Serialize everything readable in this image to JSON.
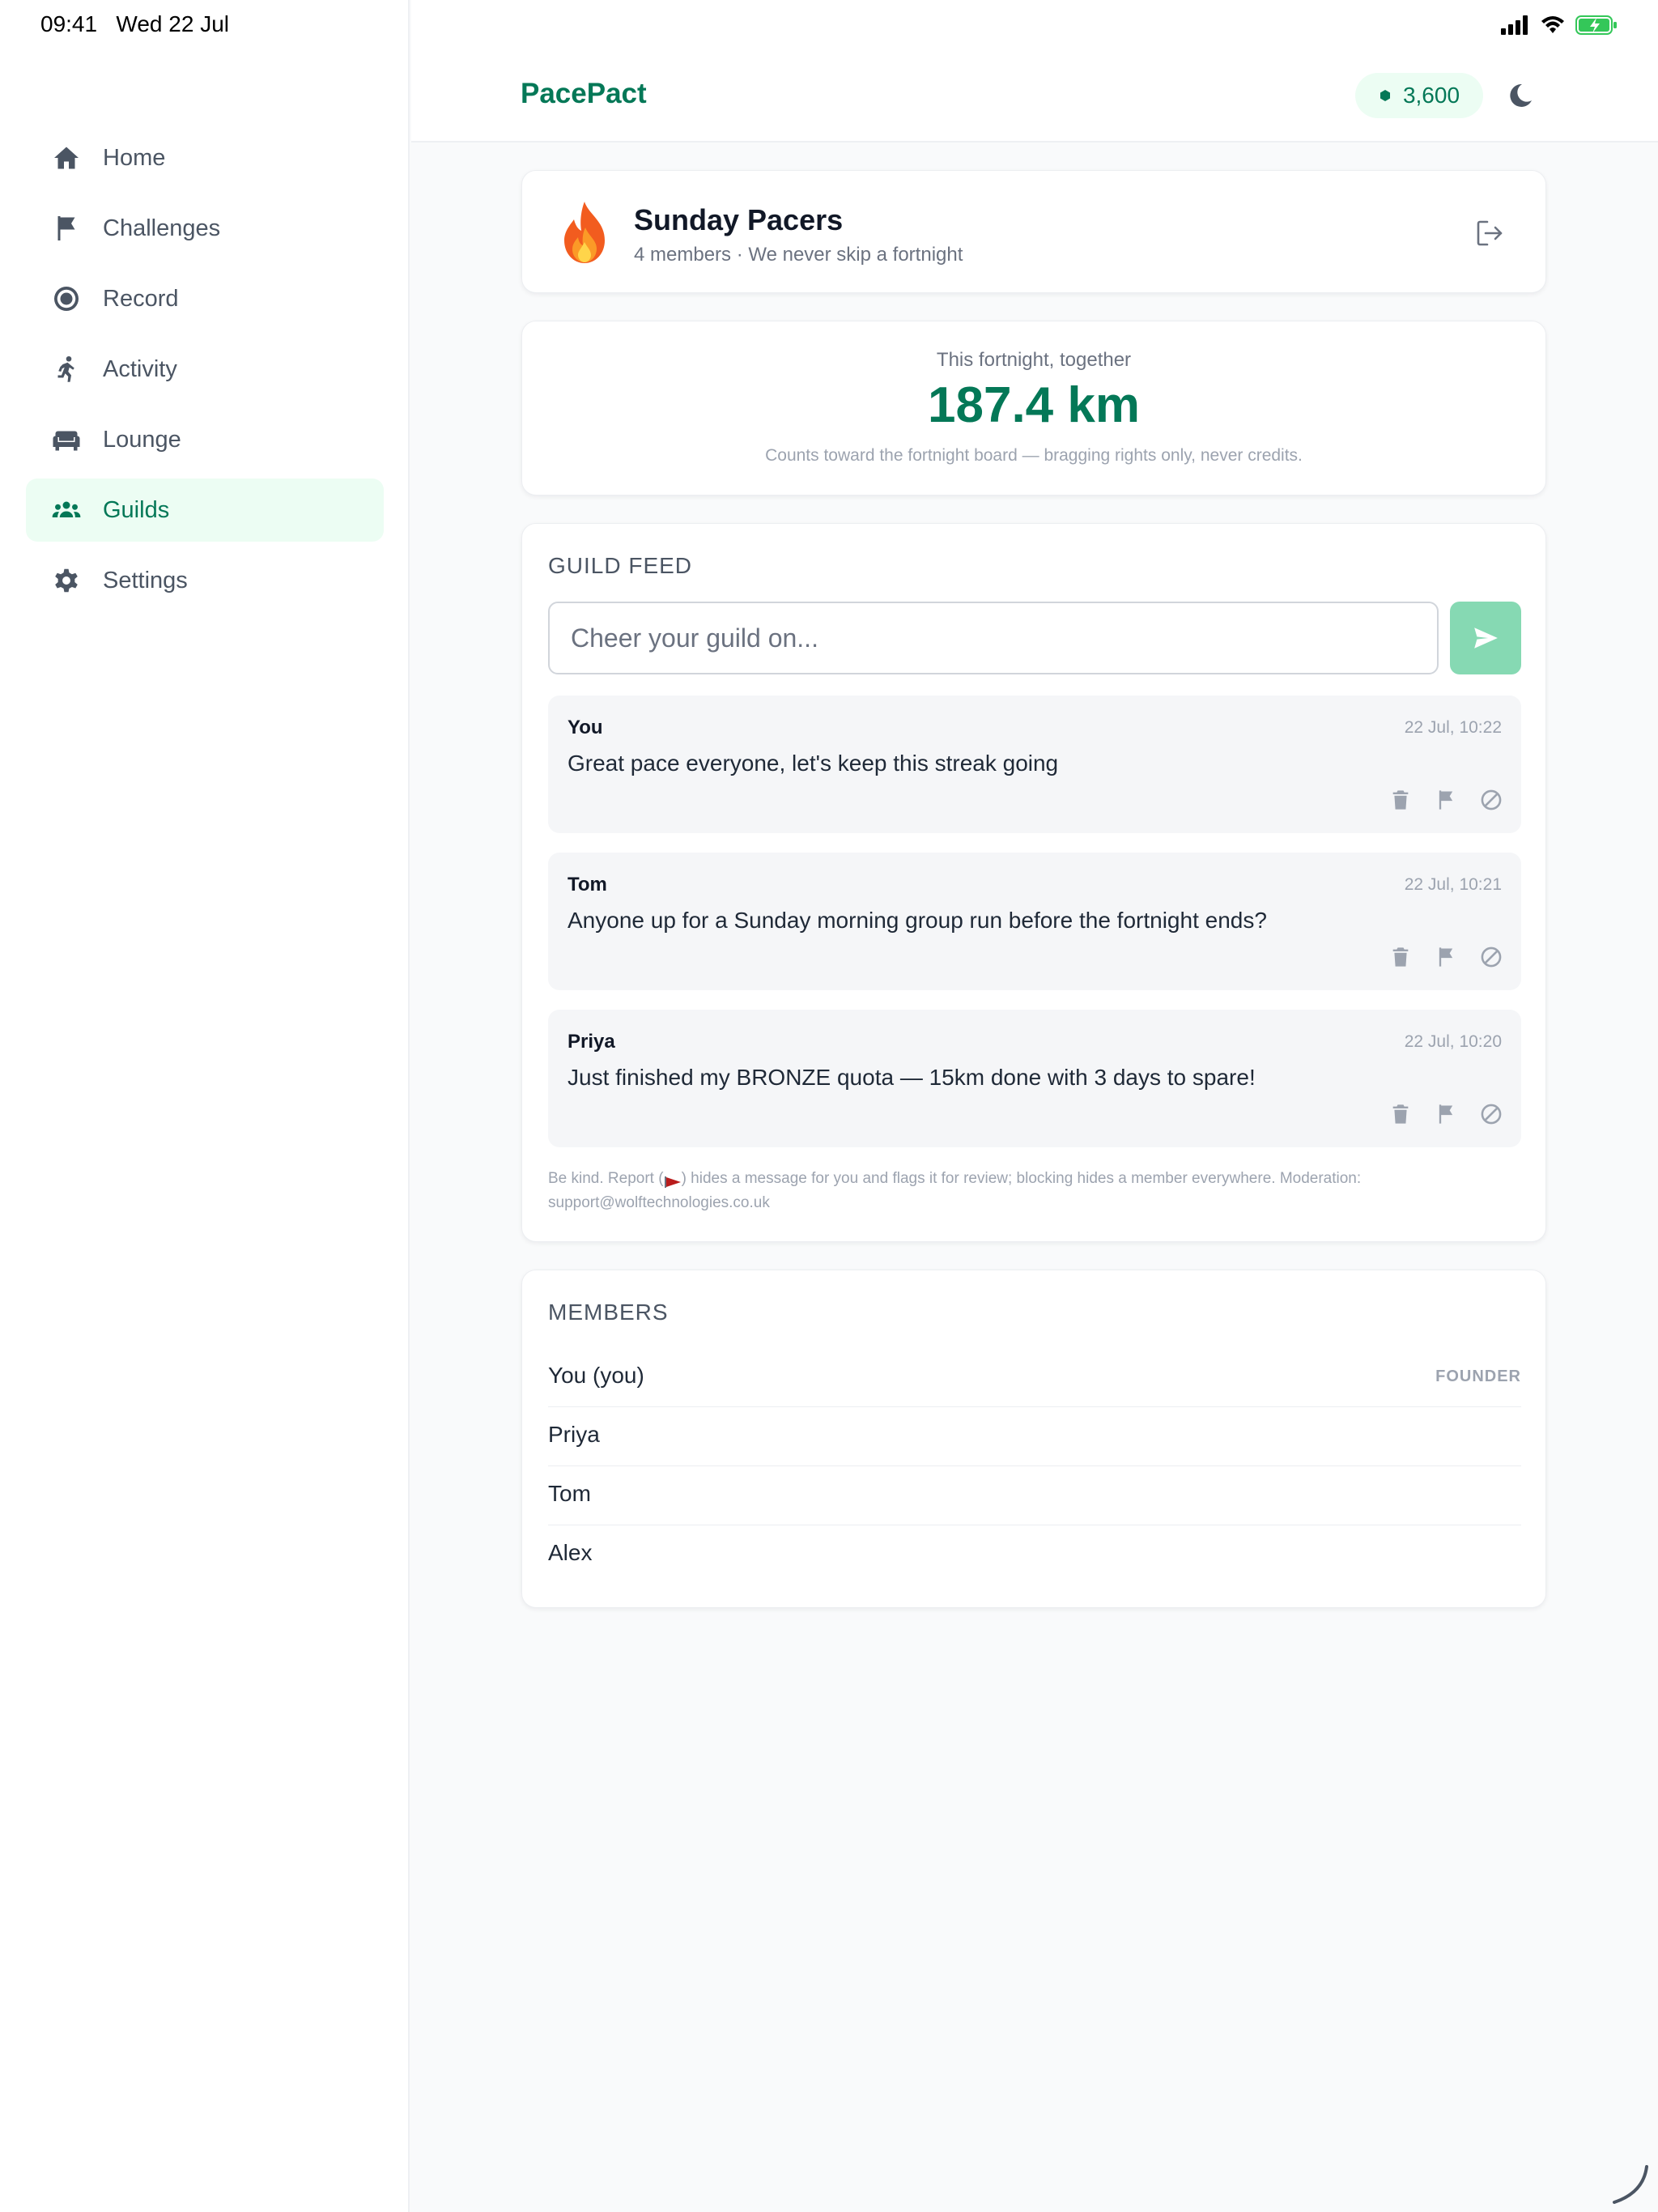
{
  "status_bar": {
    "time": "09:41",
    "date": "Wed 22 Jul",
    "icons": [
      "signal-icon",
      "wifi-icon",
      "battery-charging-icon"
    ]
  },
  "sidebar": {
    "items": [
      {
        "label": "Home",
        "icon": "home-icon",
        "active": false
      },
      {
        "label": "Challenges",
        "icon": "flag-icon",
        "active": false
      },
      {
        "label": "Record",
        "icon": "record-icon",
        "active": false
      },
      {
        "label": "Activity",
        "icon": "runner-icon",
        "active": false
      },
      {
        "label": "Lounge",
        "icon": "sofa-icon",
        "active": false
      },
      {
        "label": "Guilds",
        "icon": "group-icon",
        "active": true
      },
      {
        "label": "Settings",
        "icon": "gear-icon",
        "active": false
      }
    ]
  },
  "header": {
    "brand": "PacePact",
    "credits": "3,600",
    "theme_icon": "moon-icon"
  },
  "guild": {
    "emoji": "fire-icon",
    "name": "Sunday Pacers",
    "subtitle": "4 members · We never skip a fortnight",
    "leave_icon": "leave-icon"
  },
  "totals": {
    "label": "This fortnight, together",
    "value": "187.4 km",
    "note": "Counts toward the fortnight board — bragging rights only, never credits."
  },
  "feed": {
    "title": "GUILD FEED",
    "input_placeholder": "Cheer your guild on...",
    "input_value": "",
    "messages": [
      {
        "author": "You",
        "time": "22 Jul, 10:22",
        "text": "Great pace everyone, let's keep this streak going"
      },
      {
        "author": "Tom",
        "time": "22 Jul, 10:21",
        "text": "Anyone up for a Sunday morning group run before the fortnight ends?"
      },
      {
        "author": "Priya",
        "time": "22 Jul, 10:20",
        "text": "Just finished my BRONZE quota — 15km done with 3 days to spare!"
      }
    ],
    "footer_before": "Be kind. Report (",
    "footer_after": ") hides a message for you and flags it for review; blocking hides a member everywhere. Moderation: support@wolftechnologies.co.uk"
  },
  "members": {
    "title": "MEMBERS",
    "list": [
      {
        "name": "You (you)",
        "role": "FOUNDER"
      },
      {
        "name": "Priya",
        "role": ""
      },
      {
        "name": "Tom",
        "role": ""
      },
      {
        "name": "Alex",
        "role": ""
      }
    ]
  },
  "colors": {
    "brand": "#047857",
    "active_bg": "#ecfdf3",
    "send_button": "#86d9b3"
  }
}
